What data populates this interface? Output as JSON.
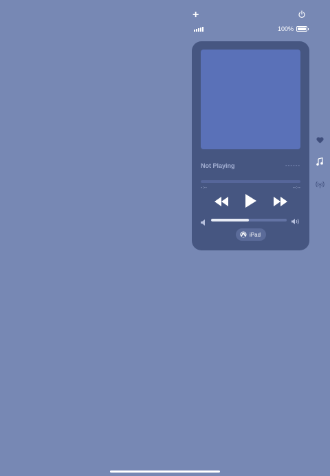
{
  "status_bar": {
    "add_icon": "plus-icon",
    "power_icon": "power-icon",
    "signal_icon": "cellular-signal-icon",
    "battery_percent": "100%",
    "battery_level": 1.0
  },
  "player": {
    "artwork_color": "#5a71b8",
    "title": "Not Playing",
    "artist": "------",
    "elapsed": "-:--",
    "remaining": "--:--",
    "controls": {
      "rewind_icon": "rewind-icon",
      "play_icon": "play-icon",
      "forward_icon": "fast-forward-icon"
    },
    "volume_level": 0.5,
    "output_device": "iPad"
  },
  "side_icons": [
    "heart-icon",
    "music-note-icon",
    "radio-broadcast-icon"
  ],
  "colors": {
    "background": "#7788b4",
    "panel": "#465681",
    "accent": "#ffffff"
  }
}
